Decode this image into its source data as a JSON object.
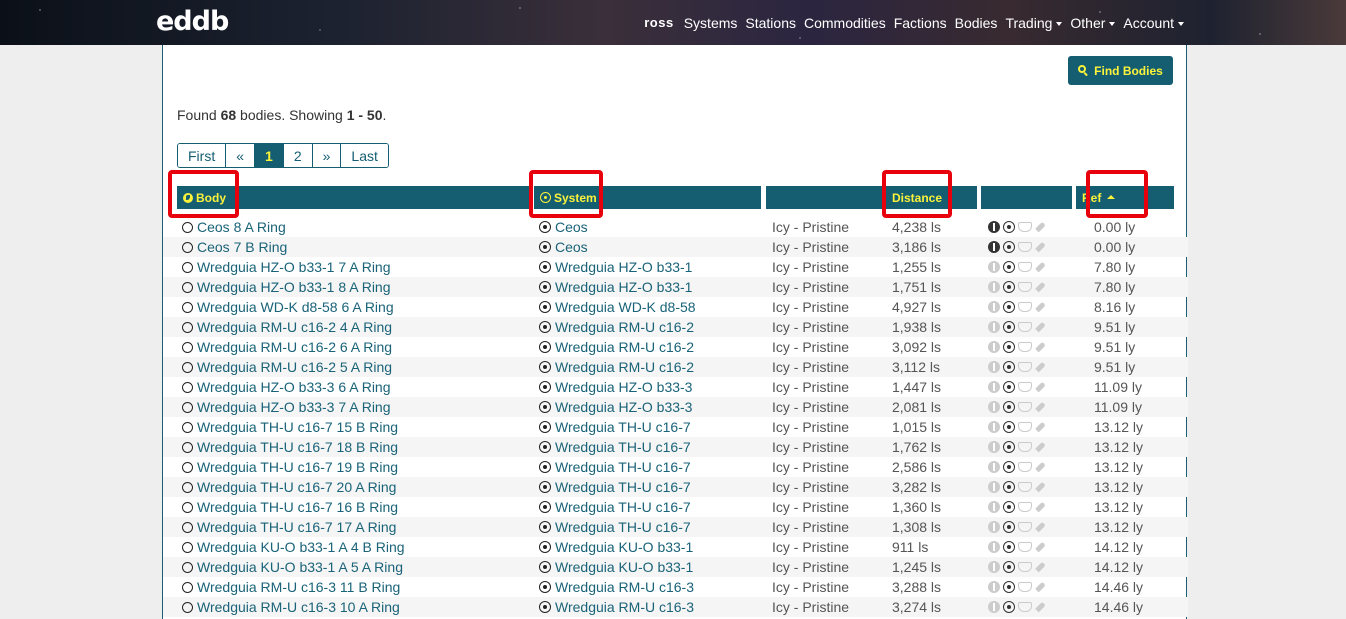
{
  "nav": {
    "logo": "eddb",
    "brand": "ross",
    "links": [
      "Systems",
      "Stations",
      "Commodities",
      "Factions",
      "Bodies"
    ],
    "dropdowns": [
      "Trading",
      "Other",
      "Account"
    ]
  },
  "find_button": {
    "icon": "search-icon",
    "label": "Find Bodies"
  },
  "summary": {
    "prefix": "Found ",
    "count": "68",
    "middle": " bodies. Showing ",
    "range": "1 - 50",
    "suffix": "."
  },
  "pagination": [
    "First",
    "«",
    "1",
    "2",
    "»",
    "Last"
  ],
  "pagination_active": "1",
  "columns": {
    "body": "Body",
    "system": "System",
    "type": "",
    "distance": "Distance",
    "icons": "",
    "ref": "Ref"
  },
  "sort": {
    "column": "ref",
    "direction": "asc"
  },
  "colors": {
    "primary": "#155e72",
    "accent": "#fbf23a",
    "highlight": "#e8000d"
  },
  "rows": [
    {
      "body": "Ceos 8 A Ring",
      "system": "Ceos",
      "type": "Icy - Pristine",
      "distance": "4,238 ls",
      "walk": true,
      "ref": "0.00 ly"
    },
    {
      "body": "Ceos 7 B Ring",
      "system": "Ceos",
      "type": "Icy - Pristine",
      "distance": "3,186 ls",
      "walk": true,
      "ref": "0.00 ly"
    },
    {
      "body": "Wredguia HZ-O b33-1 7 A Ring",
      "system": "Wredguia HZ-O b33-1",
      "type": "Icy - Pristine",
      "distance": "1,255 ls",
      "walk": false,
      "ref": "7.80 ly"
    },
    {
      "body": "Wredguia HZ-O b33-1 8 A Ring",
      "system": "Wredguia HZ-O b33-1",
      "type": "Icy - Pristine",
      "distance": "1,751 ls",
      "walk": false,
      "ref": "7.80 ly"
    },
    {
      "body": "Wredguia WD-K d8-58 6 A Ring",
      "system": "Wredguia WD-K d8-58",
      "type": "Icy - Pristine",
      "distance": "4,927 ls",
      "walk": false,
      "ref": "8.16 ly"
    },
    {
      "body": "Wredguia RM-U c16-2 4 A Ring",
      "system": "Wredguia RM-U c16-2",
      "type": "Icy - Pristine",
      "distance": "1,938 ls",
      "walk": false,
      "ref": "9.51 ly"
    },
    {
      "body": "Wredguia RM-U c16-2 6 A Ring",
      "system": "Wredguia RM-U c16-2",
      "type": "Icy - Pristine",
      "distance": "3,092 ls",
      "walk": false,
      "ref": "9.51 ly"
    },
    {
      "body": "Wredguia RM-U c16-2 5 A Ring",
      "system": "Wredguia RM-U c16-2",
      "type": "Icy - Pristine",
      "distance": "3,112 ls",
      "walk": false,
      "ref": "9.51 ly"
    },
    {
      "body": "Wredguia HZ-O b33-3 6 A Ring",
      "system": "Wredguia HZ-O b33-3",
      "type": "Icy - Pristine",
      "distance": "1,447 ls",
      "walk": false,
      "ref": "11.09 ly"
    },
    {
      "body": "Wredguia HZ-O b33-3 7 A Ring",
      "system": "Wredguia HZ-O b33-3",
      "type": "Icy - Pristine",
      "distance": "2,081 ls",
      "walk": false,
      "ref": "11.09 ly"
    },
    {
      "body": "Wredguia TH-U c16-7 15 B Ring",
      "system": "Wredguia TH-U c16-7",
      "type": "Icy - Pristine",
      "distance": "1,015 ls",
      "walk": false,
      "ref": "13.12 ly"
    },
    {
      "body": "Wredguia TH-U c16-7 18 B Ring",
      "system": "Wredguia TH-U c16-7",
      "type": "Icy - Pristine",
      "distance": "1,762 ls",
      "walk": false,
      "ref": "13.12 ly"
    },
    {
      "body": "Wredguia TH-U c16-7 19 B Ring",
      "system": "Wredguia TH-U c16-7",
      "type": "Icy - Pristine",
      "distance": "2,586 ls",
      "walk": false,
      "ref": "13.12 ly"
    },
    {
      "body": "Wredguia TH-U c16-7 20 A Ring",
      "system": "Wredguia TH-U c16-7",
      "type": "Icy - Pristine",
      "distance": "3,282 ls",
      "walk": false,
      "ref": "13.12 ly"
    },
    {
      "body": "Wredguia TH-U c16-7 16 B Ring",
      "system": "Wredguia TH-U c16-7",
      "type": "Icy - Pristine",
      "distance": "1,360 ls",
      "walk": false,
      "ref": "13.12 ly"
    },
    {
      "body": "Wredguia TH-U c16-7 17 A Ring",
      "system": "Wredguia TH-U c16-7",
      "type": "Icy - Pristine",
      "distance": "1,308 ls",
      "walk": false,
      "ref": "13.12 ly"
    },
    {
      "body": "Wredguia KU-O b33-1 A 4 B Ring",
      "system": "Wredguia KU-O b33-1",
      "type": "Icy - Pristine",
      "distance": "911 ls",
      "walk": false,
      "ref": "14.12 ly"
    },
    {
      "body": "Wredguia KU-O b33-1 A 5 A Ring",
      "system": "Wredguia KU-O b33-1",
      "type": "Icy - Pristine",
      "distance": "1,245 ls",
      "walk": false,
      "ref": "14.12 ly"
    },
    {
      "body": "Wredguia RM-U c16-3 11 B Ring",
      "system": "Wredguia RM-U c16-3",
      "type": "Icy - Pristine",
      "distance": "3,288 ls",
      "walk": false,
      "ref": "14.46 ly"
    },
    {
      "body": "Wredguia RM-U c16-3 10 A Ring",
      "system": "Wredguia RM-U c16-3",
      "type": "Icy - Pristine",
      "distance": "3,274 ls",
      "walk": false,
      "ref": "14.46 ly"
    }
  ]
}
